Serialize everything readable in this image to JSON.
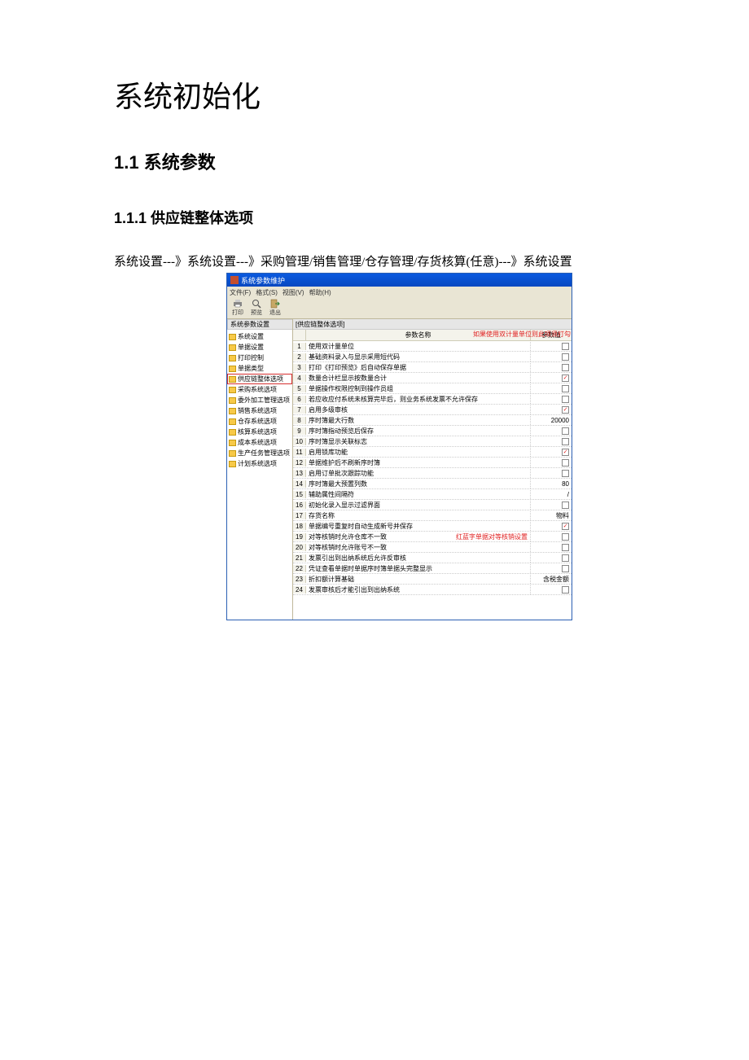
{
  "title": "系统初始化",
  "h2": "1.1 系统参数",
  "h3": "1.1.1 供应链整体选项",
  "breadcrumb": "系统设置---》系统设置---》采购管理/销售管理/仓存管理/存货核算(任意)---》系统设置",
  "app": {
    "window_title": "系统参数维护",
    "menu": {
      "file": "文件(F)",
      "format": "格式(S)",
      "view": "视图(V)",
      "help": "帮助(H)"
    },
    "toolbar": {
      "print": "打印",
      "preview": "预览",
      "exit": "退出"
    },
    "side_head": "系统参数设置",
    "tab": "[供应链整体选项]",
    "annotations": {
      "top": "如果使用双计量单位则此项须打勾",
      "row19": "红蓝字单据对等核销设置"
    },
    "tree": [
      {
        "label": "系统设置"
      },
      {
        "label": "单据设置"
      },
      {
        "label": "打印控制"
      },
      {
        "label": "单据类型"
      },
      {
        "label": "供应链整体选项",
        "selected": true
      },
      {
        "label": "采购系统选项"
      },
      {
        "label": "委外加工管理选项"
      },
      {
        "label": "销售系统选项"
      },
      {
        "label": "仓存系统选项"
      },
      {
        "label": "核算系统选项"
      },
      {
        "label": "成本系统选项"
      },
      {
        "label": "生产任务管理选项"
      },
      {
        "label": "计划系统选项"
      }
    ],
    "grid": {
      "col_name": "参数名称",
      "col_val": "参数值",
      "rows": [
        {
          "n": 1,
          "name": "使用双计量单位",
          "type": "check",
          "checked": false
        },
        {
          "n": 2,
          "name": "基础资料录入与显示采用短代码",
          "type": "check",
          "checked": false
        },
        {
          "n": 3,
          "name": "打印《打印预览》后自动保存单据",
          "type": "check",
          "checked": false
        },
        {
          "n": 4,
          "name": "数量合计栏显示按数量合计",
          "type": "check",
          "checked": true
        },
        {
          "n": 5,
          "name": "单据操作权限控制到操作员组",
          "type": "check",
          "checked": false
        },
        {
          "n": 6,
          "name": "若应收应付系统未核算完毕后，则业务系统发票不允许保存",
          "type": "check",
          "checked": false
        },
        {
          "n": 7,
          "name": "启用多级审核",
          "type": "check",
          "checked": true
        },
        {
          "n": 8,
          "name": "序时簿最大行数",
          "type": "text",
          "value": "20000"
        },
        {
          "n": 9,
          "name": "序时簿指动预览后保存",
          "type": "check",
          "checked": false
        },
        {
          "n": 10,
          "name": "序时簿显示关联标志",
          "type": "check",
          "checked": false
        },
        {
          "n": 11,
          "name": "启用锁库功能",
          "type": "check",
          "checked": true
        },
        {
          "n": 12,
          "name": "单据维护后不刷新序时簿",
          "type": "check",
          "checked": false
        },
        {
          "n": 13,
          "name": "启用订单批次跟踪功能",
          "type": "check",
          "checked": false
        },
        {
          "n": 14,
          "name": "序时簿最大预置列数",
          "type": "text",
          "value": "80"
        },
        {
          "n": 15,
          "name": "辅助属性间隔符",
          "type": "text",
          "value": "/"
        },
        {
          "n": 16,
          "name": "初始化录入显示过滤界面",
          "type": "check",
          "checked": false
        },
        {
          "n": 17,
          "name": "存货名称",
          "type": "text",
          "value": "物料"
        },
        {
          "n": 18,
          "name": "单据编号重复时自动生成新号并保存",
          "type": "check",
          "checked": true
        },
        {
          "n": 19,
          "name": "对等核销时允许仓库不一致",
          "type": "check",
          "checked": false,
          "anno": true
        },
        {
          "n": 20,
          "name": "对等核销时允许账号不一致",
          "type": "check",
          "checked": false
        },
        {
          "n": 21,
          "name": "发票引出到出纳系统后允许反审核",
          "type": "check",
          "checked": false
        },
        {
          "n": 22,
          "name": "凭证查看单据时单据序时簿单据头完整显示",
          "type": "check",
          "checked": false
        },
        {
          "n": 23,
          "name": "折扣额计算基础",
          "type": "text",
          "value": "含税金额"
        },
        {
          "n": 24,
          "name": "发票审核后才能引出到出纳系统",
          "type": "check",
          "checked": false
        }
      ]
    }
  }
}
